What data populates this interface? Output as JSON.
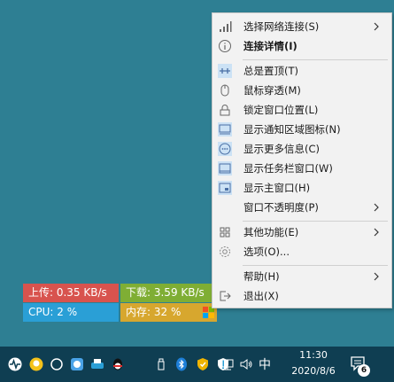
{
  "monitor": {
    "upload_label": "上传: 0.35 KB/s",
    "download_label": "下载: 3.59 KB/s",
    "cpu_label": "CPU: 2 %",
    "memory_label": "内存: 32 %",
    "colors": {
      "upload": "#d8534e",
      "download": "#7fae34",
      "cpu": "#2a9fd6",
      "memory": "#d7a72e"
    }
  },
  "menu": {
    "items": [
      {
        "label": "选择网络连接(S)",
        "icon": "signal-bars-icon",
        "submenu": true
      },
      {
        "label": "连接详情(I)",
        "icon": "info-circle-icon",
        "bold": true
      },
      {
        "label": "总是置顶(T)",
        "icon": "pin-icon",
        "checked": true
      },
      {
        "label": "鼠标穿透(M)",
        "icon": "mouse-icon"
      },
      {
        "label": "锁定窗口位置(L)",
        "icon": "lock-icon"
      },
      {
        "label": "显示通知区域图标(N)",
        "icon": "tray-icon",
        "checked": true
      },
      {
        "label": "显示更多信息(C)",
        "icon": "more-info-icon",
        "checked": true
      },
      {
        "label": "显示任务栏窗口(W)",
        "icon": "taskbar-window-icon",
        "checked": true
      },
      {
        "label": "显示主窗口(H)",
        "icon": "main-window-icon",
        "checked": true
      },
      {
        "label": "窗口不透明度(P)",
        "icon": "",
        "submenu": true
      },
      {
        "label": "其他功能(E)",
        "icon": "grid-icon",
        "submenu": true
      },
      {
        "label": "选项(O)...",
        "icon": "gear-icon"
      },
      {
        "label": "帮助(H)",
        "icon": "",
        "submenu": true
      },
      {
        "label": "退出(X)",
        "icon": "exit-icon"
      }
    ]
  },
  "taskbar": {
    "ime_label": "中",
    "time": "11:30",
    "date": "2020/8/6",
    "notification_count": "6"
  }
}
